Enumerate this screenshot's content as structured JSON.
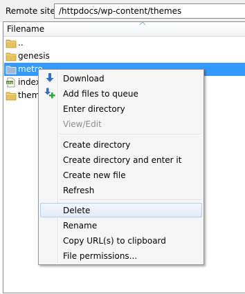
{
  "site_bar": {
    "label": "Remote site:",
    "path": "/httpdocs/wp-content/themes"
  },
  "file_list": {
    "column_header": "Filename",
    "sort_icon": "sort-up-icon",
    "rows": [
      {
        "name": "..",
        "icon": "folder-icon",
        "selected": false
      },
      {
        "name": "genesis",
        "icon": "folder-icon",
        "selected": false
      },
      {
        "name": "metro",
        "icon": "folder-icon",
        "selected": true
      },
      {
        "name": "index.",
        "icon": "php-file-icon",
        "selected": false
      },
      {
        "name": "theme",
        "icon": "folder-icon",
        "selected": false
      }
    ]
  },
  "context_menu": {
    "groups": [
      [
        {
          "label": "Download",
          "icon": "download-arrow-icon",
          "enabled": true
        },
        {
          "label": "Add files to queue",
          "icon": "add-to-queue-icon",
          "enabled": true
        },
        {
          "label": "Enter directory",
          "enabled": true
        },
        {
          "label": "View/Edit",
          "enabled": false
        }
      ],
      [
        {
          "label": "Create directory",
          "enabled": true
        },
        {
          "label": "Create directory and enter it",
          "enabled": true
        },
        {
          "label": "Create new file",
          "enabled": true
        },
        {
          "label": "Refresh",
          "enabled": true
        }
      ],
      [
        {
          "label": "Delete",
          "enabled": true,
          "hovered": true
        },
        {
          "label": "Rename",
          "enabled": true
        },
        {
          "label": "Copy URL(s) to clipboard",
          "enabled": true
        },
        {
          "label": "File permissions...",
          "enabled": true
        }
      ]
    ]
  },
  "colors": {
    "selection": "#3399ff",
    "menu_background": "#f5f5f5",
    "disabled_text": "#8c8c8c",
    "folder": "#e8c15a"
  }
}
